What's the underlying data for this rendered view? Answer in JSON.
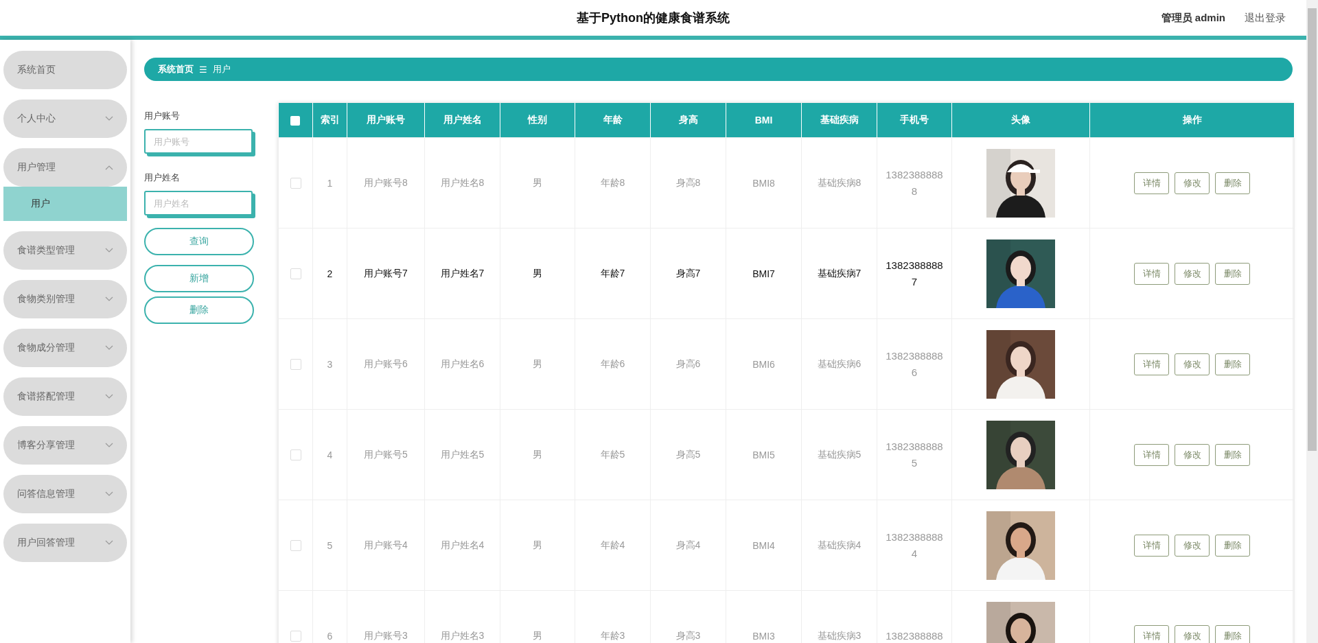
{
  "header": {
    "title": "基于Python的健康食谱系统",
    "user": "管理员 admin",
    "logout": "退出登录"
  },
  "sidebar": {
    "items": [
      {
        "label": "系统首页",
        "kind": "link"
      },
      {
        "label": "个人中心",
        "kind": "menu",
        "expanded": false
      },
      {
        "label": "用户管理",
        "kind": "menu",
        "expanded": true,
        "children": [
          {
            "label": "用户",
            "selected": true
          }
        ]
      },
      {
        "label": "食谱类型管理",
        "kind": "menu",
        "expanded": false
      },
      {
        "label": "食物类别管理",
        "kind": "menu",
        "expanded": false
      },
      {
        "label": "食物成分管理",
        "kind": "menu",
        "expanded": false
      },
      {
        "label": "食谱搭配管理",
        "kind": "menu",
        "expanded": false
      },
      {
        "label": "博客分享管理",
        "kind": "menu",
        "expanded": false
      },
      {
        "label": "问答信息管理",
        "kind": "menu",
        "expanded": false
      },
      {
        "label": "用户回答管理",
        "kind": "menu",
        "expanded": false
      }
    ]
  },
  "breadcrumb": {
    "items": [
      "系统首页",
      "用户"
    ],
    "separator": "☰"
  },
  "search": {
    "fields": [
      {
        "label": "用户账号",
        "placeholder": "用户账号"
      },
      {
        "label": "用户姓名",
        "placeholder": "用户姓名"
      }
    ],
    "buttons": [
      "查询",
      "新增",
      "删除"
    ]
  },
  "table": {
    "select_all": {
      "checked": false
    },
    "columns": [
      "索引",
      "用户账号",
      "用户姓名",
      "性别",
      "年龄",
      "身高",
      "BMI",
      "基础疾病",
      "手机号",
      "头像",
      "操作"
    ],
    "rows": [
      {
        "checked": false,
        "highlighted": false,
        "cells": [
          "1",
          "用户账号8",
          "用户姓名8",
          "男",
          "年龄8",
          "身高8",
          "BMI8",
          "基础疾病8",
          "13823888888"
        ],
        "actions": [
          "详情",
          "修改",
          "删除"
        ]
      },
      {
        "checked": false,
        "highlighted": true,
        "cells": [
          "2",
          "用户账号7",
          "用户姓名7",
          "男",
          "年龄7",
          "身高7",
          "BMI7",
          "基础疾病7",
          "13823888887"
        ],
        "actions": [
          "详情",
          "修改",
          "删除"
        ]
      },
      {
        "checked": false,
        "highlighted": false,
        "cells": [
          "3",
          "用户账号6",
          "用户姓名6",
          "男",
          "年龄6",
          "身高6",
          "BMI6",
          "基础疾病6",
          "13823888886"
        ],
        "actions": [
          "详情",
          "修改",
          "删除"
        ]
      },
      {
        "checked": false,
        "highlighted": false,
        "cells": [
          "4",
          "用户账号5",
          "用户姓名5",
          "男",
          "年龄5",
          "身高5",
          "BMI5",
          "基础疾病5",
          "13823888885"
        ],
        "actions": [
          "详情",
          "修改",
          "删除"
        ]
      },
      {
        "checked": false,
        "highlighted": false,
        "cells": [
          "5",
          "用户账号4",
          "用户姓名4",
          "男",
          "年龄4",
          "身高4",
          "BMI4",
          "基础疾病4",
          "13823888884"
        ],
        "actions": [
          "详情",
          "修改",
          "删除"
        ]
      },
      {
        "checked": false,
        "highlighted": false,
        "cells": [
          "6",
          "用户账号3",
          "用户姓名3",
          "男",
          "年龄3",
          "身高3",
          "BMI3",
          "基础疾病3",
          "1382388888"
        ],
        "actions": [
          "详情",
          "修改",
          "删除"
        ]
      }
    ]
  }
}
